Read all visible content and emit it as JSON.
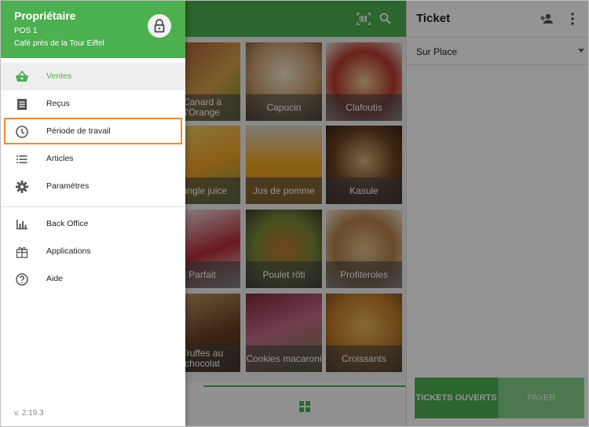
{
  "drawer": {
    "owner": "Propriétaire",
    "pos": "POS 1",
    "store": "Café près de la Tour Eiffel",
    "items": [
      {
        "label": "Ventes",
        "icon": "basket-icon",
        "active": true
      },
      {
        "label": "Reçus",
        "icon": "receipt-icon"
      },
      {
        "label": "Période de travail",
        "icon": "clock-icon",
        "highlighted": true
      },
      {
        "label": "Articles",
        "icon": "list-icon"
      },
      {
        "label": "Paramètres",
        "icon": "gear-icon"
      }
    ],
    "secondary_items": [
      {
        "label": "Back Office",
        "icon": "bar-chart-icon"
      },
      {
        "label": "Applications",
        "icon": "apps-icon"
      },
      {
        "label": "Aide",
        "icon": "help-icon"
      }
    ],
    "version": "v. 2.19.3"
  },
  "products": [
    {
      "label": "Canard à l'Orange"
    },
    {
      "label": "Capucin"
    },
    {
      "label": "Clafoutis"
    },
    {
      "label": "Jungle juice"
    },
    {
      "label": "Jus de pomme"
    },
    {
      "label": "Kasule"
    },
    {
      "label": "Parfait"
    },
    {
      "label": "Poulet rôti"
    },
    {
      "label": "Profiteroles"
    },
    {
      "label": "Truffes au chocolat"
    },
    {
      "label": "Cookies macaroni"
    },
    {
      "label": "Croissants"
    }
  ],
  "ticket": {
    "title": "Ticket",
    "dining_option": "Sur Place",
    "open_tickets_button": "TICKETS OUVERTS",
    "pay_button": "PAYER"
  },
  "colors": {
    "accent": "#4caf50",
    "highlight_outline": "#f08a30"
  }
}
